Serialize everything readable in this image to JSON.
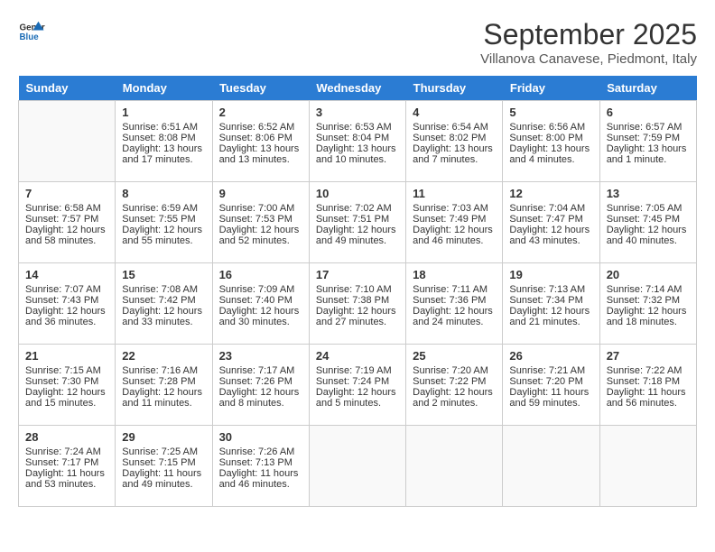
{
  "header": {
    "logo_line1": "General",
    "logo_line2": "Blue",
    "month": "September 2025",
    "location": "Villanova Canavese, Piedmont, Italy"
  },
  "weekdays": [
    "Sunday",
    "Monday",
    "Tuesday",
    "Wednesday",
    "Thursday",
    "Friday",
    "Saturday"
  ],
  "weeks": [
    [
      {
        "day": "",
        "empty": true
      },
      {
        "day": "1",
        "sunrise": "Sunrise: 6:51 AM",
        "sunset": "Sunset: 8:08 PM",
        "daylight": "Daylight: 13 hours and 17 minutes."
      },
      {
        "day": "2",
        "sunrise": "Sunrise: 6:52 AM",
        "sunset": "Sunset: 8:06 PM",
        "daylight": "Daylight: 13 hours and 13 minutes."
      },
      {
        "day": "3",
        "sunrise": "Sunrise: 6:53 AM",
        "sunset": "Sunset: 8:04 PM",
        "daylight": "Daylight: 13 hours and 10 minutes."
      },
      {
        "day": "4",
        "sunrise": "Sunrise: 6:54 AM",
        "sunset": "Sunset: 8:02 PM",
        "daylight": "Daylight: 13 hours and 7 minutes."
      },
      {
        "day": "5",
        "sunrise": "Sunrise: 6:56 AM",
        "sunset": "Sunset: 8:00 PM",
        "daylight": "Daylight: 13 hours and 4 minutes."
      },
      {
        "day": "6",
        "sunrise": "Sunrise: 6:57 AM",
        "sunset": "Sunset: 7:59 PM",
        "daylight": "Daylight: 13 hours and 1 minute."
      }
    ],
    [
      {
        "day": "7",
        "sunrise": "Sunrise: 6:58 AM",
        "sunset": "Sunset: 7:57 PM",
        "daylight": "Daylight: 12 hours and 58 minutes."
      },
      {
        "day": "8",
        "sunrise": "Sunrise: 6:59 AM",
        "sunset": "Sunset: 7:55 PM",
        "daylight": "Daylight: 12 hours and 55 minutes."
      },
      {
        "day": "9",
        "sunrise": "Sunrise: 7:00 AM",
        "sunset": "Sunset: 7:53 PM",
        "daylight": "Daylight: 12 hours and 52 minutes."
      },
      {
        "day": "10",
        "sunrise": "Sunrise: 7:02 AM",
        "sunset": "Sunset: 7:51 PM",
        "daylight": "Daylight: 12 hours and 49 minutes."
      },
      {
        "day": "11",
        "sunrise": "Sunrise: 7:03 AM",
        "sunset": "Sunset: 7:49 PM",
        "daylight": "Daylight: 12 hours and 46 minutes."
      },
      {
        "day": "12",
        "sunrise": "Sunrise: 7:04 AM",
        "sunset": "Sunset: 7:47 PM",
        "daylight": "Daylight: 12 hours and 43 minutes."
      },
      {
        "day": "13",
        "sunrise": "Sunrise: 7:05 AM",
        "sunset": "Sunset: 7:45 PM",
        "daylight": "Daylight: 12 hours and 40 minutes."
      }
    ],
    [
      {
        "day": "14",
        "sunrise": "Sunrise: 7:07 AM",
        "sunset": "Sunset: 7:43 PM",
        "daylight": "Daylight: 12 hours and 36 minutes."
      },
      {
        "day": "15",
        "sunrise": "Sunrise: 7:08 AM",
        "sunset": "Sunset: 7:42 PM",
        "daylight": "Daylight: 12 hours and 33 minutes."
      },
      {
        "day": "16",
        "sunrise": "Sunrise: 7:09 AM",
        "sunset": "Sunset: 7:40 PM",
        "daylight": "Daylight: 12 hours and 30 minutes."
      },
      {
        "day": "17",
        "sunrise": "Sunrise: 7:10 AM",
        "sunset": "Sunset: 7:38 PM",
        "daylight": "Daylight: 12 hours and 27 minutes."
      },
      {
        "day": "18",
        "sunrise": "Sunrise: 7:11 AM",
        "sunset": "Sunset: 7:36 PM",
        "daylight": "Daylight: 12 hours and 24 minutes."
      },
      {
        "day": "19",
        "sunrise": "Sunrise: 7:13 AM",
        "sunset": "Sunset: 7:34 PM",
        "daylight": "Daylight: 12 hours and 21 minutes."
      },
      {
        "day": "20",
        "sunrise": "Sunrise: 7:14 AM",
        "sunset": "Sunset: 7:32 PM",
        "daylight": "Daylight: 12 hours and 18 minutes."
      }
    ],
    [
      {
        "day": "21",
        "sunrise": "Sunrise: 7:15 AM",
        "sunset": "Sunset: 7:30 PM",
        "daylight": "Daylight: 12 hours and 15 minutes."
      },
      {
        "day": "22",
        "sunrise": "Sunrise: 7:16 AM",
        "sunset": "Sunset: 7:28 PM",
        "daylight": "Daylight: 12 hours and 11 minutes."
      },
      {
        "day": "23",
        "sunrise": "Sunrise: 7:17 AM",
        "sunset": "Sunset: 7:26 PM",
        "daylight": "Daylight: 12 hours and 8 minutes."
      },
      {
        "day": "24",
        "sunrise": "Sunrise: 7:19 AM",
        "sunset": "Sunset: 7:24 PM",
        "daylight": "Daylight: 12 hours and 5 minutes."
      },
      {
        "day": "25",
        "sunrise": "Sunrise: 7:20 AM",
        "sunset": "Sunset: 7:22 PM",
        "daylight": "Daylight: 12 hours and 2 minutes."
      },
      {
        "day": "26",
        "sunrise": "Sunrise: 7:21 AM",
        "sunset": "Sunset: 7:20 PM",
        "daylight": "Daylight: 11 hours and 59 minutes."
      },
      {
        "day": "27",
        "sunrise": "Sunrise: 7:22 AM",
        "sunset": "Sunset: 7:18 PM",
        "daylight": "Daylight: 11 hours and 56 minutes."
      }
    ],
    [
      {
        "day": "28",
        "sunrise": "Sunrise: 7:24 AM",
        "sunset": "Sunset: 7:17 PM",
        "daylight": "Daylight: 11 hours and 53 minutes."
      },
      {
        "day": "29",
        "sunrise": "Sunrise: 7:25 AM",
        "sunset": "Sunset: 7:15 PM",
        "daylight": "Daylight: 11 hours and 49 minutes."
      },
      {
        "day": "30",
        "sunrise": "Sunrise: 7:26 AM",
        "sunset": "Sunset: 7:13 PM",
        "daylight": "Daylight: 11 hours and 46 minutes."
      },
      {
        "day": "",
        "empty": true
      },
      {
        "day": "",
        "empty": true
      },
      {
        "day": "",
        "empty": true
      },
      {
        "day": "",
        "empty": true
      }
    ]
  ]
}
